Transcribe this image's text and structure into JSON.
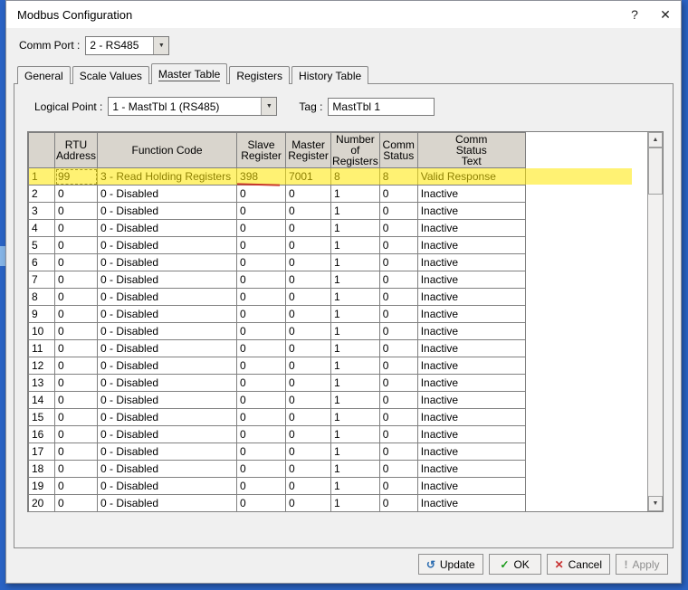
{
  "window": {
    "title": "Modbus Configuration",
    "help_icon": "?",
    "close_icon": "✕"
  },
  "comm_port": {
    "label": "Comm Port :",
    "value": "2 - RS485"
  },
  "tabs": [
    "General",
    "Scale Values",
    "Master Table",
    "Registers",
    "History Table"
  ],
  "active_tab": "Master Table",
  "logical_point": {
    "label": "Logical Point :",
    "value": "1 - MastTbl 1  (RS485)"
  },
  "tag": {
    "label": "Tag :",
    "value": "MastTbl 1"
  },
  "grid": {
    "headers": {
      "row": "",
      "rtu": "RTU\nAddress",
      "func": "Function Code",
      "slave": "Slave\nRegister",
      "master": "Master\nRegister",
      "nregs": "Number\nof\nRegisters",
      "comm": "Comm\nStatus",
      "text": "Comm\nStatus\nText"
    },
    "rows": [
      {
        "num": "1",
        "rtu": "99",
        "func": "3 - Read Holding Registers",
        "slave": "398",
        "master": "7001",
        "nregs": "8",
        "comm": "8",
        "text": "Valid Response"
      },
      {
        "num": "2",
        "rtu": "0",
        "func": "0 - Disabled",
        "slave": "0",
        "master": "0",
        "nregs": "1",
        "comm": "0",
        "text": "Inactive"
      },
      {
        "num": "3",
        "rtu": "0",
        "func": "0 - Disabled",
        "slave": "0",
        "master": "0",
        "nregs": "1",
        "comm": "0",
        "text": "Inactive"
      },
      {
        "num": "4",
        "rtu": "0",
        "func": "0 - Disabled",
        "slave": "0",
        "master": "0",
        "nregs": "1",
        "comm": "0",
        "text": "Inactive"
      },
      {
        "num": "5",
        "rtu": "0",
        "func": "0 - Disabled",
        "slave": "0",
        "master": "0",
        "nregs": "1",
        "comm": "0",
        "text": "Inactive"
      },
      {
        "num": "6",
        "rtu": "0",
        "func": "0 - Disabled",
        "slave": "0",
        "master": "0",
        "nregs": "1",
        "comm": "0",
        "text": "Inactive"
      },
      {
        "num": "7",
        "rtu": "0",
        "func": "0 - Disabled",
        "slave": "0",
        "master": "0",
        "nregs": "1",
        "comm": "0",
        "text": "Inactive"
      },
      {
        "num": "8",
        "rtu": "0",
        "func": "0 - Disabled",
        "slave": "0",
        "master": "0",
        "nregs": "1",
        "comm": "0",
        "text": "Inactive"
      },
      {
        "num": "9",
        "rtu": "0",
        "func": "0 - Disabled",
        "slave": "0",
        "master": "0",
        "nregs": "1",
        "comm": "0",
        "text": "Inactive"
      },
      {
        "num": "10",
        "rtu": "0",
        "func": "0 - Disabled",
        "slave": "0",
        "master": "0",
        "nregs": "1",
        "comm": "0",
        "text": "Inactive"
      },
      {
        "num": "11",
        "rtu": "0",
        "func": "0 - Disabled",
        "slave": "0",
        "master": "0",
        "nregs": "1",
        "comm": "0",
        "text": "Inactive"
      },
      {
        "num": "12",
        "rtu": "0",
        "func": "0 - Disabled",
        "slave": "0",
        "master": "0",
        "nregs": "1",
        "comm": "0",
        "text": "Inactive"
      },
      {
        "num": "13",
        "rtu": "0",
        "func": "0 - Disabled",
        "slave": "0",
        "master": "0",
        "nregs": "1",
        "comm": "0",
        "text": "Inactive"
      },
      {
        "num": "14",
        "rtu": "0",
        "func": "0 - Disabled",
        "slave": "0",
        "master": "0",
        "nregs": "1",
        "comm": "0",
        "text": "Inactive"
      },
      {
        "num": "15",
        "rtu": "0",
        "func": "0 - Disabled",
        "slave": "0",
        "master": "0",
        "nregs": "1",
        "comm": "0",
        "text": "Inactive"
      },
      {
        "num": "16",
        "rtu": "0",
        "func": "0 - Disabled",
        "slave": "0",
        "master": "0",
        "nregs": "1",
        "comm": "0",
        "text": "Inactive"
      },
      {
        "num": "17",
        "rtu": "0",
        "func": "0 - Disabled",
        "slave": "0",
        "master": "0",
        "nregs": "1",
        "comm": "0",
        "text": "Inactive"
      },
      {
        "num": "18",
        "rtu": "0",
        "func": "0 - Disabled",
        "slave": "0",
        "master": "0",
        "nregs": "1",
        "comm": "0",
        "text": "Inactive"
      },
      {
        "num": "19",
        "rtu": "0",
        "func": "0 - Disabled",
        "slave": "0",
        "master": "0",
        "nregs": "1",
        "comm": "0",
        "text": "Inactive"
      },
      {
        "num": "20",
        "rtu": "0",
        "func": "0 - Disabled",
        "slave": "0",
        "master": "0",
        "nregs": "1",
        "comm": "0",
        "text": "Inactive"
      }
    ]
  },
  "annotations": {
    "highlight_row": 1,
    "highlight_color": "#ffe800",
    "underlined_value": "398",
    "underline_color": "#c9372a"
  },
  "scrollbar": {
    "up_icon": "▲",
    "down_icon": "▼"
  },
  "buttons": [
    {
      "id": "update",
      "label": "Update",
      "icon": "↺",
      "icon_color": "#2b6cb0",
      "enabled": true
    },
    {
      "id": "ok",
      "label": "OK",
      "icon": "✓",
      "icon_color": "#189a18",
      "enabled": true
    },
    {
      "id": "cancel",
      "label": "Cancel",
      "icon": "✕",
      "icon_color": "#c83232",
      "enabled": true
    },
    {
      "id": "apply",
      "label": "Apply",
      "icon": "!",
      "icon_color": "#9a9a9a",
      "enabled": false
    }
  ]
}
